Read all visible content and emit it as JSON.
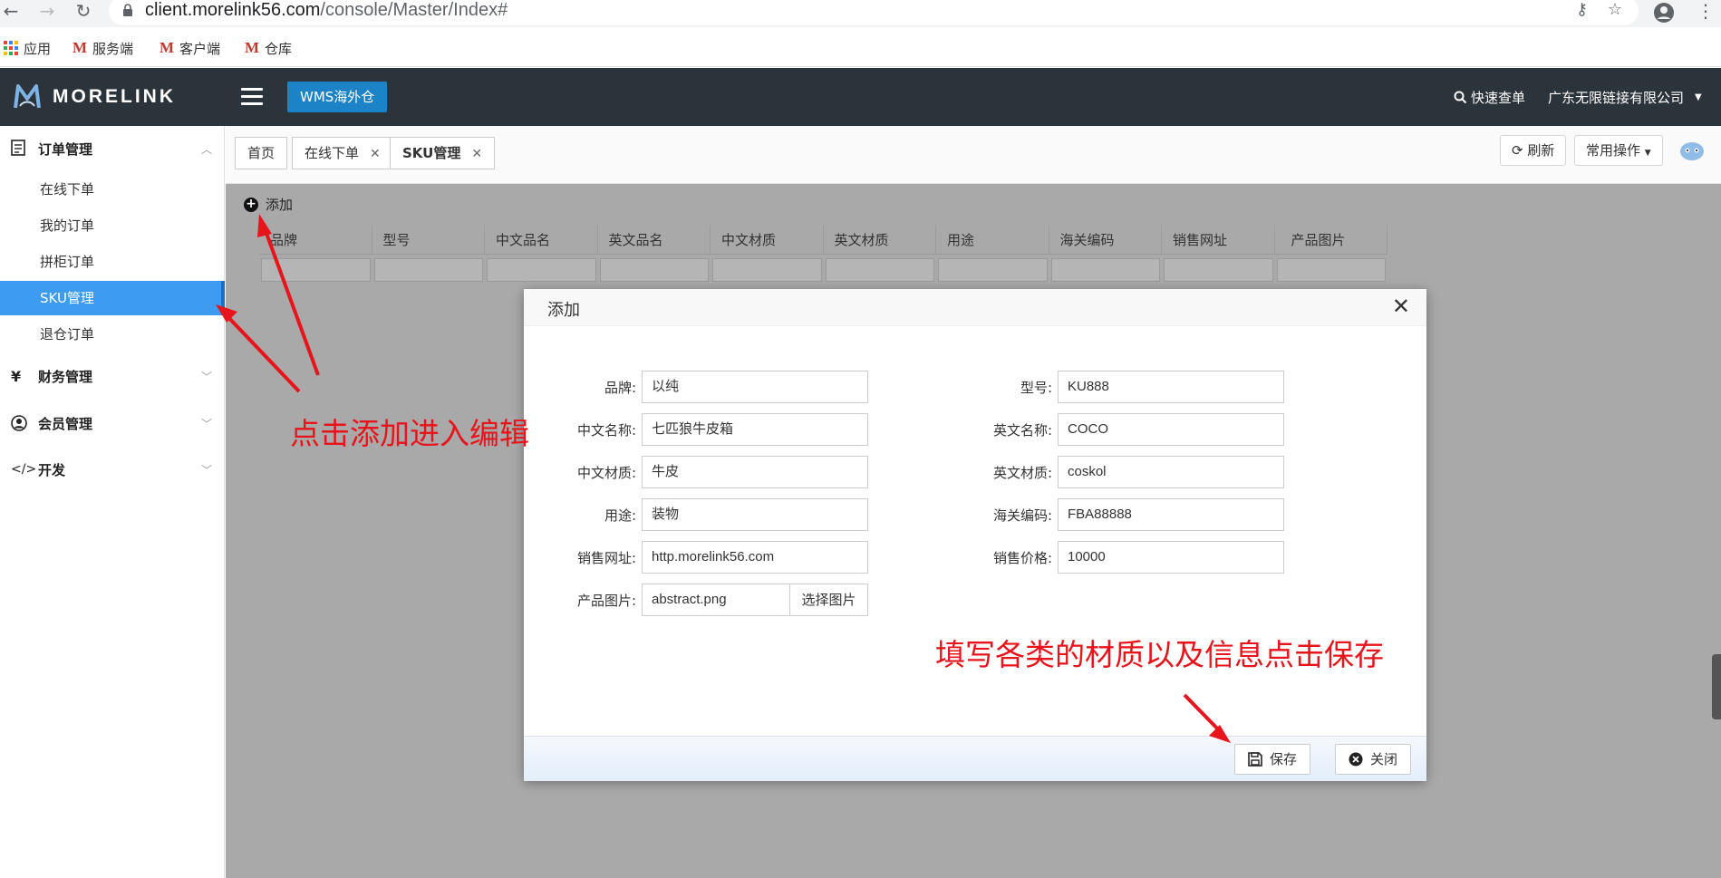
{
  "browser": {
    "url_host": "client.morelink56.com",
    "url_path": "/console/Master/Index#",
    "bookmarks": [
      {
        "label": "应用"
      },
      {
        "label": "服务端"
      },
      {
        "label": "客户端"
      },
      {
        "label": "仓库"
      }
    ]
  },
  "header": {
    "logo_text": "MORELINK",
    "wms_button": "WMS海外仓",
    "quick_search": "快速查单",
    "company": "广东无限链接有限公司"
  },
  "sidebar": {
    "groups": [
      {
        "label": "订单管理",
        "icon": "order-icon"
      },
      {
        "label": "财务管理",
        "icon": "yen-icon"
      },
      {
        "label": "会员管理",
        "icon": "user-icon"
      },
      {
        "label": "开发",
        "icon": "code-icon"
      }
    ],
    "order_items": [
      "在线下单",
      "我的订单",
      "拼柜订单",
      "SKU管理",
      "退仓订单"
    ]
  },
  "tabs": {
    "items": [
      "首页",
      "在线下单",
      "SKU管理"
    ],
    "refresh": "刷新",
    "common_ops": "常用操作"
  },
  "grid": {
    "add_label": "添加",
    "columns": [
      "品牌",
      "型号",
      "中文品名",
      "英文品名",
      "中文材质",
      "英文材质",
      "用途",
      "海关编码",
      "销售网址",
      "产品图片"
    ]
  },
  "modal": {
    "title": "添加",
    "left_fields": [
      {
        "label": "品牌:",
        "value": "以纯"
      },
      {
        "label": "中文名称:",
        "value": "七匹狼牛皮箱"
      },
      {
        "label": "中文材质:",
        "value": "牛皮"
      },
      {
        "label": "用途:",
        "value": "装物"
      },
      {
        "label": "销售网址:",
        "value": "http.morelink56.com"
      }
    ],
    "right_fields": [
      {
        "label": "型号:",
        "value": "KU888"
      },
      {
        "label": "英文名称:",
        "value": "COCO"
      },
      {
        "label": "英文材质:",
        "value": "coskol"
      },
      {
        "label": "海关编码:",
        "value": "FBA88888"
      },
      {
        "label": "销售价格:",
        "value": "10000"
      }
    ],
    "image_label": "产品图片:",
    "image_file": "abstract.png",
    "choose_image": "选择图片",
    "save": "保存",
    "close": "关闭"
  },
  "annotations": {
    "click_add": "点击添加进入编辑",
    "fill_save": "填写各类的材质以及信息点击保存"
  }
}
